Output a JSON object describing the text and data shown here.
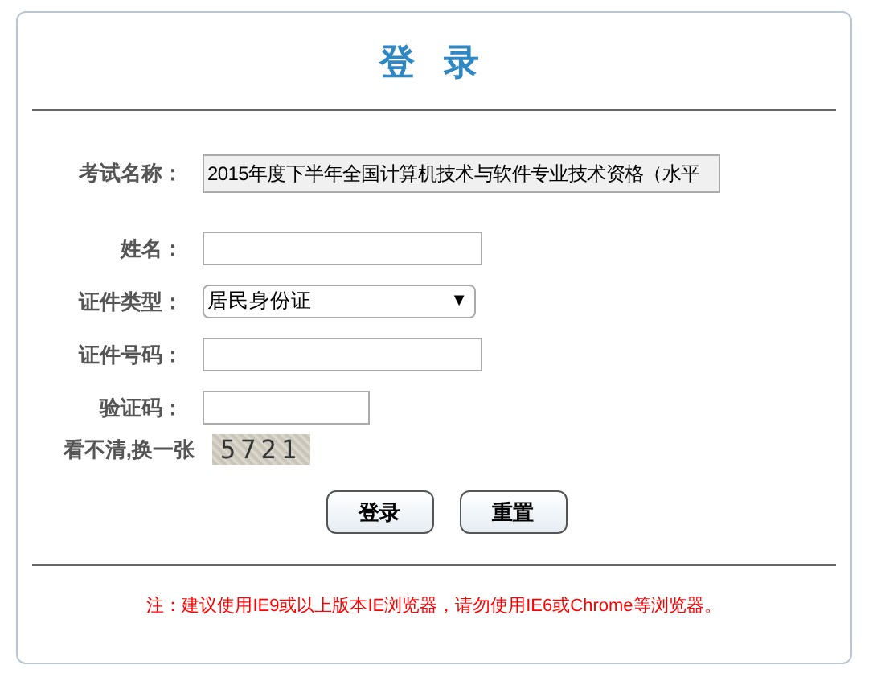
{
  "title": "登 录",
  "fields": [
    {
      "kind": "readonly",
      "label": "考试名称：",
      "value": "2015年度下半年全国计算机技术与软件专业技术资格（水平"
    },
    {
      "kind": "text",
      "label": "姓名："
    },
    {
      "kind": "select",
      "label": "证件类型：",
      "value": "居民身份证",
      "arrow": "▼"
    },
    {
      "kind": "text",
      "label": "证件号码："
    },
    {
      "kind": "captcha-input",
      "label": "验证码："
    }
  ],
  "captcha": {
    "label": "看不清,换一张",
    "code": "5721"
  },
  "buttons": [
    "登录",
    "重置"
  ],
  "note": "注：建议使用IE9或以上版本IE浏览器，请勿使用IE6或Chrome等浏览器。"
}
